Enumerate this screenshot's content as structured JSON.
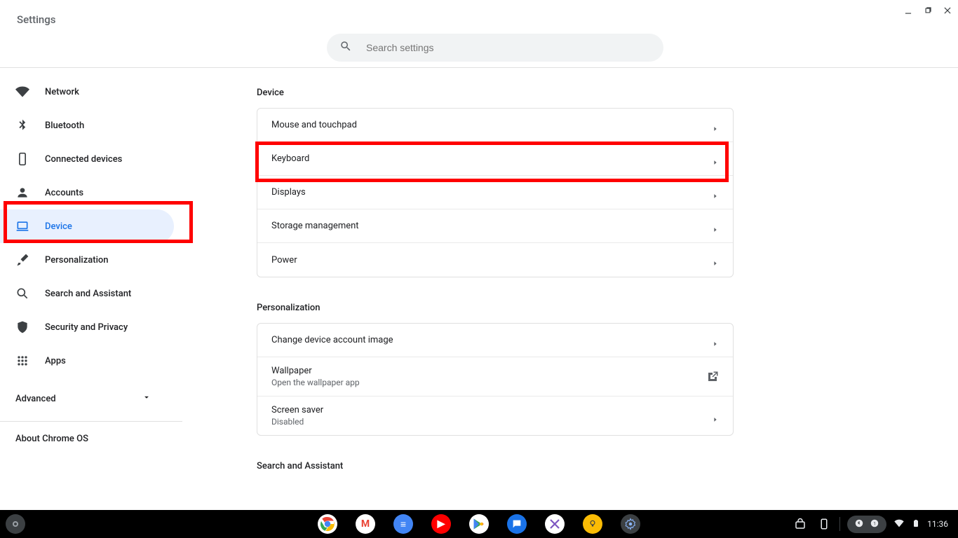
{
  "header": {
    "title": "Settings",
    "search_placeholder": "Search settings"
  },
  "sidebar": {
    "items": [
      {
        "id": "network",
        "label": "Network"
      },
      {
        "id": "bluetooth",
        "label": "Bluetooth"
      },
      {
        "id": "connected-devices",
        "label": "Connected devices"
      },
      {
        "id": "accounts",
        "label": "Accounts"
      },
      {
        "id": "device",
        "label": "Device"
      },
      {
        "id": "personalization",
        "label": "Personalization"
      },
      {
        "id": "search-assistant",
        "label": "Search and Assistant"
      },
      {
        "id": "security-privacy",
        "label": "Security and Privacy"
      },
      {
        "id": "apps",
        "label": "Apps"
      }
    ],
    "advanced_label": "Advanced",
    "about_label": "About Chrome OS"
  },
  "sections": {
    "device": {
      "title": "Device",
      "rows": [
        {
          "label": "Mouse and touchpad"
        },
        {
          "label": "Keyboard"
        },
        {
          "label": "Displays"
        },
        {
          "label": "Storage management"
        },
        {
          "label": "Power"
        }
      ]
    },
    "personalization": {
      "title": "Personalization",
      "rows": [
        {
          "label": "Change device account image"
        },
        {
          "label": "Wallpaper",
          "sub": "Open the wallpaper app",
          "external": true
        },
        {
          "label": "Screen saver",
          "sub": "Disabled"
        }
      ]
    },
    "search_assistant": {
      "title": "Search and Assistant"
    }
  },
  "shelf": {
    "apps": [
      "chrome",
      "gmail",
      "docs",
      "youtube",
      "play",
      "messages",
      "editor",
      "keep",
      "settings"
    ],
    "time": "11:36"
  }
}
